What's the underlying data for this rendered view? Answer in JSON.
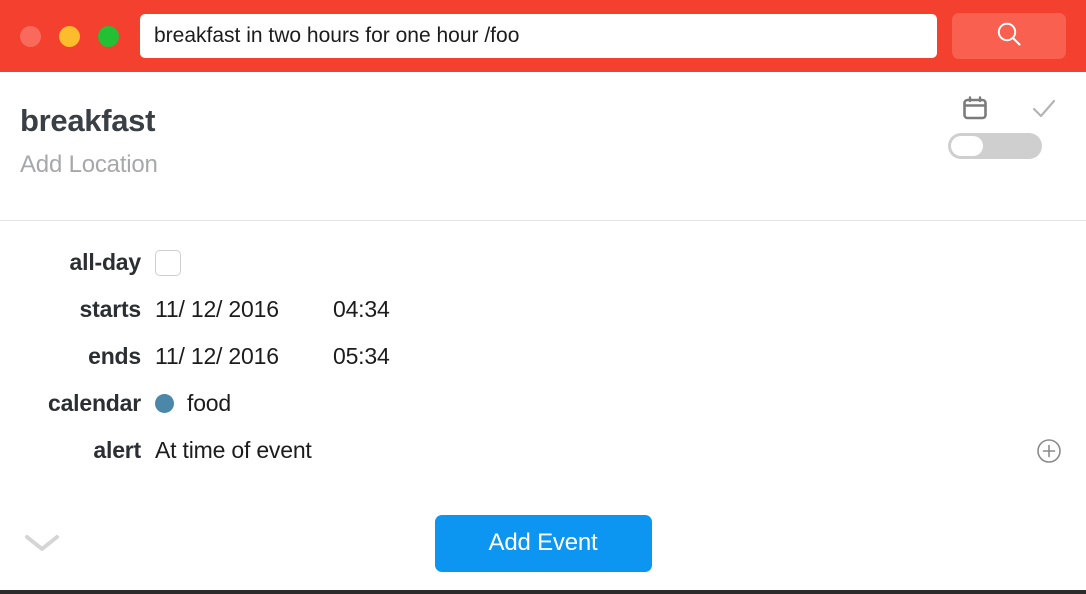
{
  "titlebar": {
    "traffic_lights": [
      {
        "name": "close",
        "color": "#f96a5c"
      },
      {
        "name": "minimize",
        "color": "#fcbc2b"
      },
      {
        "name": "maximize",
        "color": "#23c036"
      }
    ],
    "search": {
      "value": "breakfast in two hours for one hour /foo",
      "placeholder": "",
      "icon": "search-icon"
    },
    "background_color": "#f4412f"
  },
  "event": {
    "title": "breakfast",
    "location_placeholder": "Add Location",
    "actions": {
      "calendar_icon": "calendar-icon",
      "check_icon": "check-icon",
      "toggle_state": "off"
    }
  },
  "details": {
    "rows": [
      {
        "label": "all-day",
        "type": "checkbox",
        "checked": false
      },
      {
        "label": "starts",
        "type": "datetime",
        "date": "11/ 12/ 2016",
        "time": "04:34"
      },
      {
        "label": "ends",
        "type": "datetime",
        "date": "11/ 12/ 2016",
        "time": "05:34"
      },
      {
        "label": "calendar",
        "type": "calendar",
        "value": "food",
        "color": "#4a87a8"
      },
      {
        "label": "alert",
        "type": "alert",
        "value": "At time of event",
        "add_icon": "plus-circle-icon"
      }
    ]
  },
  "footer": {
    "expand_icon": "chevron-down-icon",
    "submit_label": "Add Event",
    "submit_color": "#0d95f2"
  }
}
